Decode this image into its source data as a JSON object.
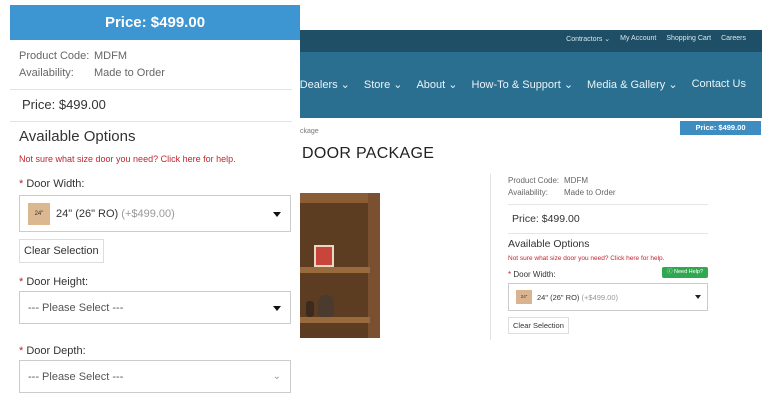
{
  "colors": {
    "price_bar": "#3d95d2",
    "site_topbar": "#1f4f66",
    "site_nav": "#2b6f90",
    "required": "#c0262d",
    "need_help": "#2fa84f"
  },
  "mobile": {
    "price_bar": "Price: $499.00",
    "product_code_label": "Product Code:",
    "product_code": "MDFM",
    "availability_label": "Availability:",
    "availability": "Made to Order",
    "price": "Price: $499.00",
    "options_title": "Available Options",
    "help_link": "Not sure what size door you need? Click here for help.",
    "required_mark": "*",
    "door_width": {
      "label": "Door Width:",
      "thumb": "24\"",
      "value": "24\" (26\" RO)",
      "addon": "(+$499.00)",
      "icon": "caret-down-icon"
    },
    "clear_selection": "Clear Selection",
    "door_height": {
      "label": "Door Height:",
      "value": "--- Please Select ---",
      "icon": "caret-down-icon"
    },
    "door_depth": {
      "label": "Door Depth:",
      "value": "--- Please Select ---",
      "icon": "chevron-down-icon"
    }
  },
  "site": {
    "top_links": [
      "Contractors ⌄",
      "My Account",
      "Shopping Cart",
      "Careers"
    ],
    "nav": [
      "Dealers ⌄",
      "Store ⌄",
      "About ⌄",
      "How-To & Support ⌄",
      "Media & Gallery ⌄",
      "Contact Us"
    ],
    "mini_price": "Price: $499.00",
    "breadcrumb": "ckage",
    "page_title": "DOOR PACKAGE",
    "product_code_label": "Product Code:",
    "product_code": "MDFM",
    "availability_label": "Availability:",
    "availability": "Made to Order",
    "price": "Price: $499.00",
    "options_title": "Available Options",
    "help_link": "Not sure what size door you need? Click here for help.",
    "door_width_label": "Door Width:",
    "need_help": "Need Help?",
    "width_thumb": "24\"",
    "width_value": "24\" (26\" RO)",
    "width_addon": "(+$499.00)",
    "clear_selection": "Clear Selection"
  }
}
